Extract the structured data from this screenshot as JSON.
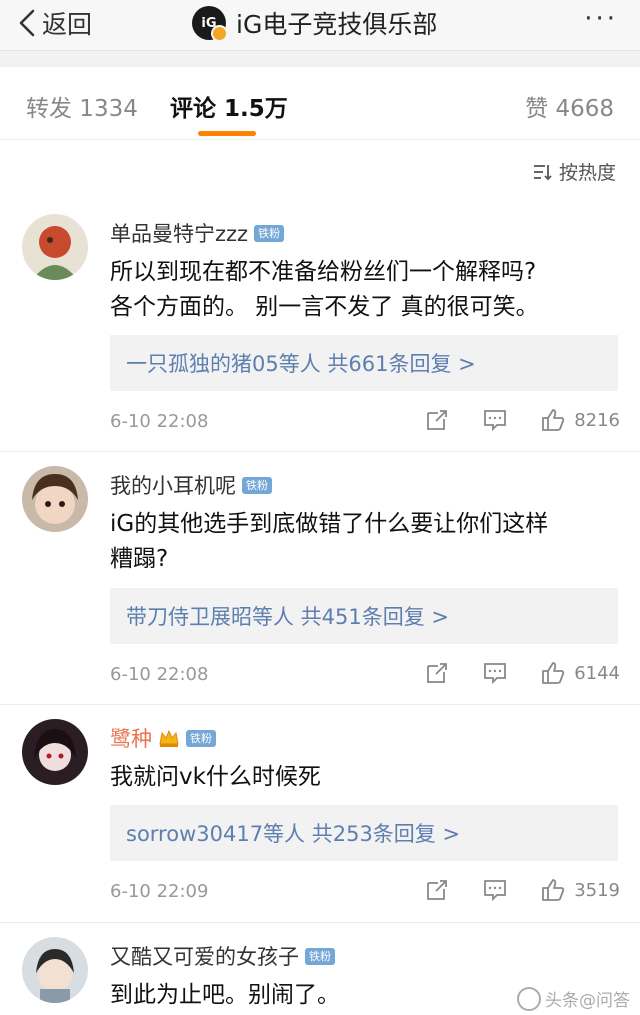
{
  "nav": {
    "back_label": "返回",
    "title": "iG电子竞技俱乐部",
    "more": "···"
  },
  "tabs": {
    "repost": "转发 1334",
    "comment": "评论 1.5万",
    "like": "赞 4668"
  },
  "sort_label": "按热度",
  "comments": [
    {
      "username": "单品曼特宁zzz",
      "badge": "铁粉",
      "text_line1": "所以到现在都不准备给粉丝们一个解释吗?",
      "text_line2": "各个方面的。 别一言不发了 真的很可笑。",
      "replies": "一只孤独的猪05等人  共661条回复 >",
      "time": "6-10 22:08",
      "likes": "8216"
    },
    {
      "username": "我的小耳机呢",
      "badge": "铁粉",
      "text_line1": "iG的其他选手到底做错了什么要让你们这样",
      "text_line2": "糟蹋?",
      "replies": "带刀侍卫展昭等人  共451条回复 >",
      "time": "6-10 22:08",
      "likes": "6144"
    },
    {
      "username": "鹭种",
      "badge": "铁粉",
      "text_line1": "我就问vk什么时候死",
      "replies": "sorrow30417等人  共253条回复 >",
      "time": "6-10 22:09",
      "likes": "3519"
    },
    {
      "username": "又酷又可爱的女孩子",
      "badge": "铁粉",
      "text_line1": "到此为止吧。别闹了。"
    }
  ],
  "watermark": "头条@问答",
  "colors": {
    "accent": "#ff8200",
    "link": "#5d7fb0",
    "vip_name": "#eb7350",
    "badge_bg": "#74a7d6"
  }
}
